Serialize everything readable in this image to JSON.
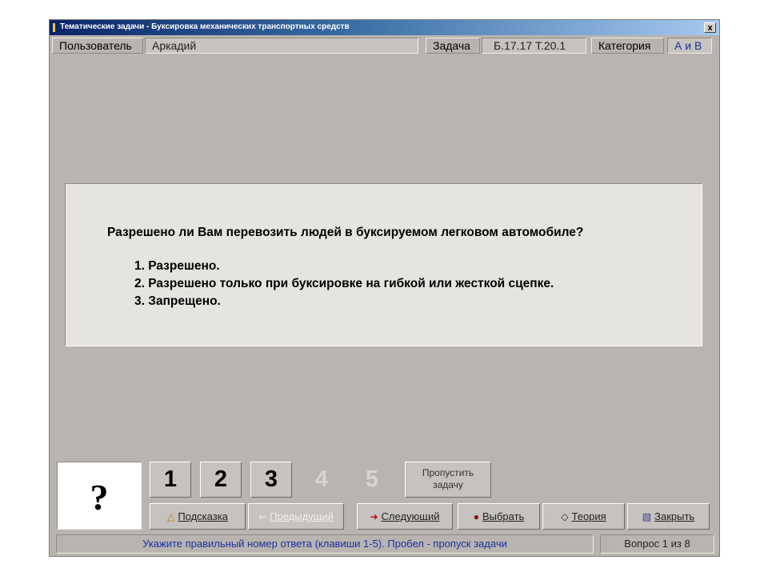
{
  "window": {
    "title": "Тематические задачи - Буксировка механических транспортных средств",
    "close_label": "x"
  },
  "infobar": {
    "user_label": "Пользователь",
    "user_value": "Аркадий",
    "task_label": "Задача",
    "task_value": "Б.17.17  Т.20.1",
    "category_label": "Категория",
    "category_value": "А и В"
  },
  "question": {
    "text": "Разрешено ли Вам перевозить людей в буксируемом легковом автомобиле?",
    "answers": [
      "1. Разрешено.",
      "2. Разрешено только при буксировке на гибкой или жесткой сцепке.",
      "3. Запрещено."
    ]
  },
  "answer_box": {
    "symbol": "?"
  },
  "number_buttons": [
    {
      "label": "1",
      "enabled": true
    },
    {
      "label": "2",
      "enabled": true
    },
    {
      "label": "3",
      "enabled": true
    },
    {
      "label": "4",
      "enabled": false
    },
    {
      "label": "5",
      "enabled": false
    }
  ],
  "skip_button": {
    "line1": "Пропустить",
    "line2": "задачу"
  },
  "action_buttons": [
    {
      "label": "Подсказка",
      "icon": "hint-icon",
      "enabled": true
    },
    {
      "label": "Предыдущий",
      "icon": "arrow-left-icon",
      "enabled": false
    },
    {
      "label": "Следующий",
      "icon": "arrow-right-icon",
      "enabled": true
    },
    {
      "label": "Выбрать",
      "icon": "select-icon",
      "enabled": true
    },
    {
      "label": "Теория",
      "icon": "theory-icon",
      "enabled": true
    },
    {
      "label": "Закрыть",
      "icon": "close-door-icon",
      "enabled": true
    }
  ],
  "status": {
    "hint": "Укажите правильный номер ответа (клавиши 1-5). Пробел - пропуск задачи",
    "counter": "Вопрос 1 из 8"
  },
  "colors": {
    "background": "#b9b4af",
    "panel": "#e6e4e0",
    "accent_text": "#1a2fa5",
    "title_bar_start": "#0a246a",
    "title_bar_end": "#a6caf0"
  }
}
